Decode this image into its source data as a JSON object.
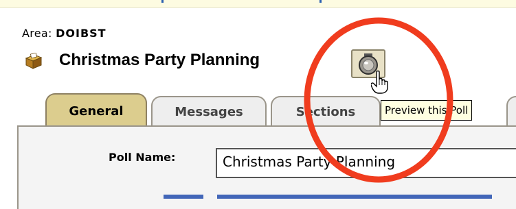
{
  "area": {
    "label": "Area:",
    "value": "DOIBST"
  },
  "poll": {
    "title": "Christmas Party Planning",
    "title_icon": "ballot-box-icon"
  },
  "preview_button": {
    "icon": "preview-icon",
    "tooltip": "Preview this Poll"
  },
  "tabs": [
    {
      "label": "General",
      "active": true
    },
    {
      "label": "Messages",
      "active": false
    },
    {
      "label": "Sections",
      "active": false
    }
  ],
  "form": {
    "poll_name_label": "Poll Name:",
    "poll_name_value": "Christmas Party Planning"
  },
  "colors": {
    "active_tab": "#dccd8e",
    "annotation_circle": "#f03c1e",
    "tooltip_background": "#ffffe1"
  }
}
